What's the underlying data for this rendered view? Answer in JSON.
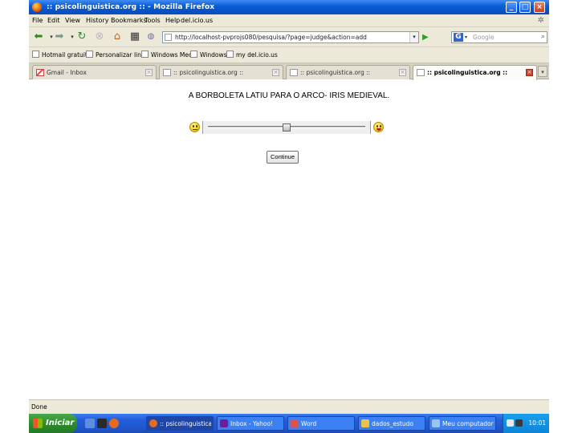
{
  "window": {
    "title": ":: psicolinguistica.org :: - Mozilla Firefox",
    "controls": [
      "minimize",
      "maximize",
      "close"
    ]
  },
  "menu": [
    "File",
    "Edit",
    "View",
    "History",
    "Bookmarks",
    "Tools",
    "Help",
    "del.icio.us"
  ],
  "toolbar": {
    "url": "http://localhost-pvprojs080/pesquisa/?page=judge&action=add",
    "search_placeholder": "Google"
  },
  "bookmarks": [
    "Hotmail gratuito",
    "Personalizar links",
    "Windows Media",
    "Windows",
    "my del.icio.us"
  ],
  "tabs": [
    {
      "label": "Gmail - Inbox",
      "active": false
    },
    {
      "label": ":: psicolinguistica.org ::",
      "active": false
    },
    {
      "label": ":: psicolinguistica.org ::",
      "active": false
    },
    {
      "label": ":: psicolinguistica.org ::",
      "active": true
    }
  ],
  "page": {
    "question": "A BORBOLETA LATIU PARA O ARCO- IRIS MEDIEVAL.",
    "slider_value": 0.5,
    "continue_label": "Continue"
  },
  "status": "Done",
  "taskbar": {
    "start_label": "Iniciar",
    "items": [
      {
        "label": ":: psicolinguistica.o...",
        "active": true
      },
      {
        "label": "Inbox - Yahoo!",
        "active": false
      },
      {
        "label": "Word",
        "active": false
      },
      {
        "label": "dados_estudo",
        "active": false
      },
      {
        "label": "Meu computador",
        "active": false
      }
    ],
    "clock": "10:01"
  }
}
